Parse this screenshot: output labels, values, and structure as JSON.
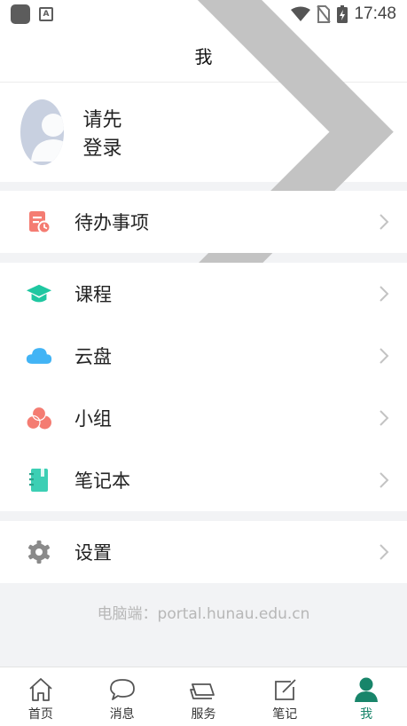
{
  "status_bar": {
    "time": "17:48"
  },
  "header": {
    "title": "我"
  },
  "profile": {
    "label": "请先登录"
  },
  "todo": {
    "label": "待办事项",
    "color": "#f47c72"
  },
  "apps": [
    {
      "label": "课程",
      "icon": "graduation-cap-icon",
      "color": "#1fc7a1"
    },
    {
      "label": "云盘",
      "icon": "cloud-icon",
      "color": "#42b4f5"
    },
    {
      "label": "小组",
      "icon": "group-circles-icon",
      "color": "#f47c72"
    },
    {
      "label": "笔记本",
      "icon": "notebook-icon",
      "color": "#3ccfb4"
    }
  ],
  "settings": {
    "label": "设置",
    "color": "#8a8a8a"
  },
  "footer_note": "电脑端：portal.hunau.edu.cn",
  "tabs": [
    {
      "label": "首页",
      "icon": "home-icon"
    },
    {
      "label": "消息",
      "icon": "message-icon"
    },
    {
      "label": "服务",
      "icon": "service-icon"
    },
    {
      "label": "笔记",
      "icon": "note-icon"
    },
    {
      "label": "我",
      "icon": "person-icon",
      "active": true
    }
  ],
  "accent_color": "#18856a"
}
